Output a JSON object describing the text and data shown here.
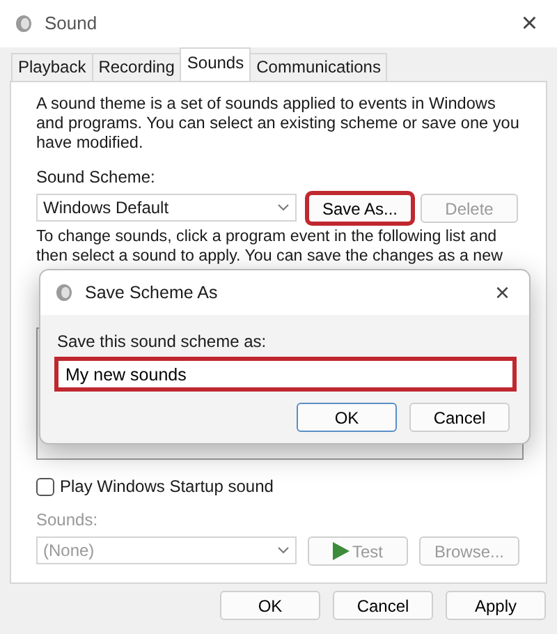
{
  "window": {
    "title": "Sound",
    "close": "×"
  },
  "tabs": [
    {
      "label": "Playback",
      "selected": false
    },
    {
      "label": "Recording",
      "selected": false
    },
    {
      "label": "Sounds",
      "selected": true
    },
    {
      "label": "Communications",
      "selected": false
    }
  ],
  "sounds_tab": {
    "description": "A sound theme is a set of sounds applied to events in Windows and programs.  You can select an existing scheme or save one you have modified.",
    "scheme_label": "Sound Scheme:",
    "scheme_value": "Windows Default",
    "scheme_buttons": [
      {
        "label": "Save As...",
        "disabled": false,
        "highlighted": true
      },
      {
        "label": "Delete",
        "disabled": true,
        "highlighted": false
      }
    ],
    "instructions": [
      "To change sounds, click a program event in the following list and",
      "then select a sound to apply.  You can save the changes as a new"
    ],
    "startup_checkbox": {
      "label": "Play Windows Startup sound",
      "checked": false
    },
    "sounds_label": "Sounds:",
    "sounds_value": "(None)",
    "sound_buttons": [
      {
        "label": "Test",
        "kind": "play",
        "disabled": true
      },
      {
        "label": "Browse...",
        "kind": "plain",
        "disabled": true
      }
    ]
  },
  "footer_buttons": [
    {
      "label": "OK",
      "disabled": false
    },
    {
      "label": "Cancel",
      "disabled": false
    },
    {
      "label": "Apply",
      "disabled": false
    }
  ],
  "dialog": {
    "title": "Save Scheme As",
    "close": "×",
    "label": "Save this sound scheme as:",
    "value": "My new sounds",
    "highlighted": true,
    "buttons": [
      {
        "label": "OK",
        "default": true
      },
      {
        "label": "Cancel",
        "default": false
      }
    ]
  }
}
